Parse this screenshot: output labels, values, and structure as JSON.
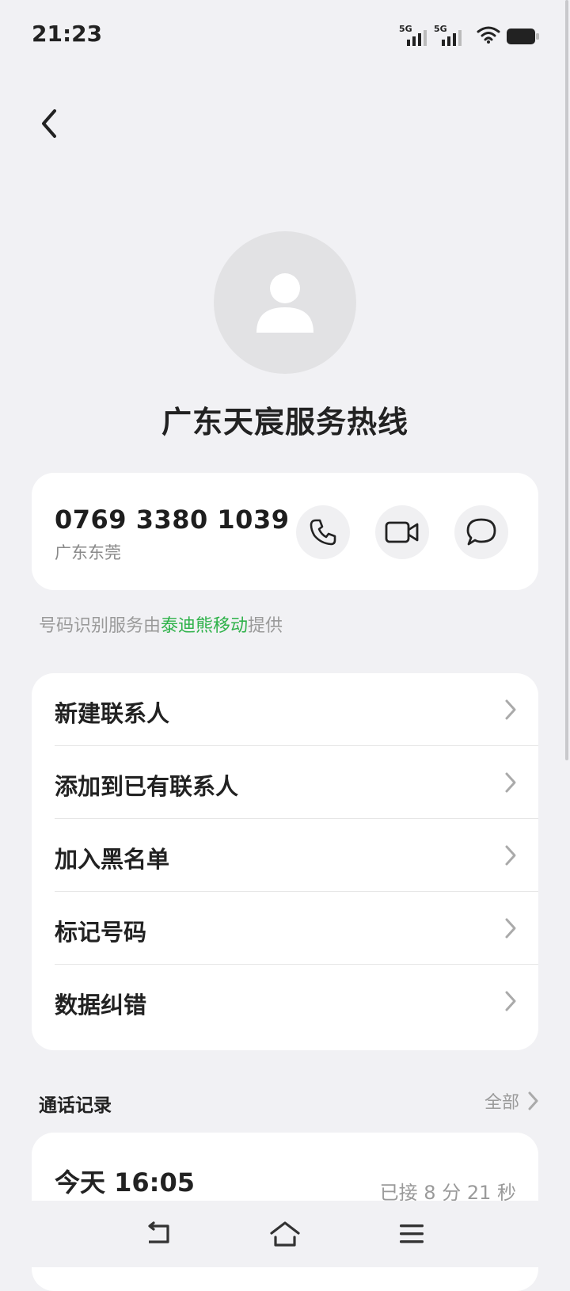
{
  "status_bar": {
    "time": "21:23",
    "signal_1_label": "5G",
    "signal_2_label": "5G",
    "wifi_icon": "wifi-icon",
    "battery_icon": "battery-icon"
  },
  "header": {
    "back_icon": "chevron-left-icon"
  },
  "contact": {
    "name": "广东天宸服务热线",
    "avatar_icon": "person-icon"
  },
  "number_card": {
    "number": "0769 3380 1039",
    "location": "广东东莞",
    "actions": [
      {
        "icon": "phone-icon"
      },
      {
        "icon": "video-call-icon"
      },
      {
        "icon": "message-icon"
      }
    ]
  },
  "provider": {
    "prefix": "号码识别服务由",
    "name": "泰迪熊移动",
    "suffix": "提供",
    "accent_color": "#2fb24a"
  },
  "menu": {
    "items": [
      {
        "label": "新建联系人"
      },
      {
        "label": "添加到已有联系人"
      },
      {
        "label": "加入黑名单"
      },
      {
        "label": "标记号码"
      },
      {
        "label": "数据纠错"
      }
    ]
  },
  "call_log": {
    "title": "通话记录",
    "all_label": "全部",
    "entries": [
      {
        "time": "今天 16:05",
        "status": "已接 8 分 21 秒"
      }
    ]
  },
  "nav_bar": {
    "back_icon": "back-icon",
    "home_icon": "home-icon",
    "menu_icon": "menu-icon"
  }
}
